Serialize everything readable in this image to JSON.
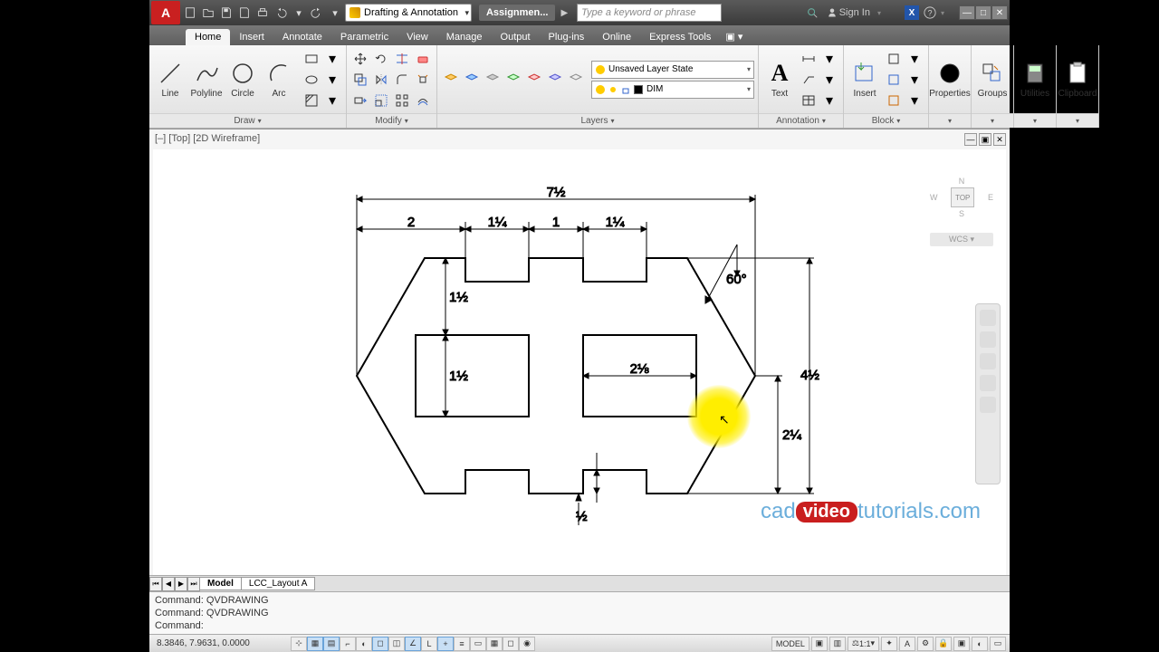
{
  "titlebar": {
    "workspace": "Drafting & Annotation",
    "doc_tab": "Assignmen...",
    "search_placeholder": "Type a keyword or phrase",
    "signin": "Sign In"
  },
  "tabs": [
    "Home",
    "Insert",
    "Annotate",
    "Parametric",
    "View",
    "Manage",
    "Output",
    "Plug-ins",
    "Online",
    "Express Tools"
  ],
  "active_tab": "Home",
  "panels": {
    "draw": {
      "title": "Draw",
      "tools": [
        "Line",
        "Polyline",
        "Circle",
        "Arc"
      ]
    },
    "modify": {
      "title": "Modify"
    },
    "layers": {
      "title": "Layers",
      "state": "Unsaved Layer State",
      "current": "DIM"
    },
    "annotation": {
      "title": "Annotation",
      "text": "Text"
    },
    "block": {
      "title": "Block",
      "insert": "Insert"
    },
    "properties": {
      "title": "Properties"
    },
    "groups": {
      "title": "Groups"
    },
    "utilities": {
      "title": "Utilities"
    },
    "clipboard": {
      "title": "Clipboard"
    }
  },
  "viewport": {
    "label": "[–] [Top] [2D Wireframe]",
    "cube_top": "TOP",
    "cube_n": "N",
    "cube_s": "S",
    "cube_e": "E",
    "cube_w": "W",
    "wcs": "WCS"
  },
  "dimensions": {
    "d1": "7½",
    "d2": "2",
    "d3": "1¼",
    "d4": "1",
    "d5": "1¼",
    "d6": "60°",
    "d7": "1½",
    "d8": "1½",
    "d9": "2⅛",
    "d10": "4½",
    "d11": "2¼",
    "d12": "½"
  },
  "layout_tabs": [
    "Model",
    "LCC_Layout A"
  ],
  "cmd": {
    "l1": "Command: QVDRAWING",
    "l2": "Command: QVDRAWING",
    "l3": "Command:"
  },
  "status": {
    "coords": "8.3846, 7.9631, 0.0000",
    "model": "MODEL",
    "scale": "1:1"
  },
  "watermark": {
    "p1": "cad",
    "p2": "video",
    "p3": "tutorials.com"
  }
}
